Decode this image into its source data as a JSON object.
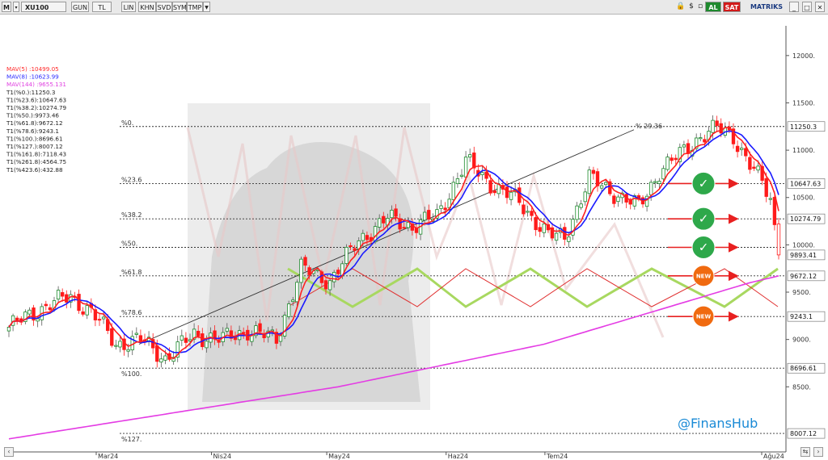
{
  "toolbar": {
    "symbol": "XU100",
    "buttons": [
      "GUN",
      "TL",
      "LIN",
      "KHN",
      "SVD",
      "SYM",
      "TMP"
    ],
    "buy_label": "AL",
    "sell_label": "SAT",
    "brand": "MATRIKS"
  },
  "legend": [
    {
      "text": "MAV(5)   :10499.05",
      "color": "#ff2a2a"
    },
    {
      "text": "MAV(8)   :10623.99",
      "color": "#2a2aff"
    },
    {
      "text": "MAV(144)  :9655.131",
      "color": "#e040e0"
    },
    {
      "text": "T1(%0.):11250.3",
      "color": "#222222"
    },
    {
      "text": "T1(%23.6):10647.63",
      "color": "#222222"
    },
    {
      "text": "T1(%38.2):10274.79",
      "color": "#222222"
    },
    {
      "text": "T1(%50.):9973.46",
      "color": "#222222"
    },
    {
      "text": "T1(%61.8):9672.12",
      "color": "#222222"
    },
    {
      "text": "T1(%78.6):9243.1",
      "color": "#222222"
    },
    {
      "text": "T1(%100.):8696.61",
      "color": "#222222"
    },
    {
      "text": "T1(%127.):8007.12",
      "color": "#222222"
    },
    {
      "text": "T1(%161.8):7118.43",
      "color": "#222222"
    },
    {
      "text": "T1(%261.8):4564.75",
      "color": "#222222"
    },
    {
      "text": "T1(%423.6):432.88",
      "color": "#222222"
    }
  ],
  "colors": {
    "up_candle": "#1a8a2a",
    "down_candle": "#ff1a1a",
    "mav5": "#ff2020",
    "mav8": "#1a1aff",
    "mav144": "#e43ce4",
    "fib_line": "#333333",
    "green_zigzag": "#a8d860",
    "red_zigzag": "#e03030",
    "badge_check": "#2ea84a",
    "badge_new": "#f06a10",
    "arrow": "#e82020",
    "watermark": "#1a8ad6"
  },
  "watermark_text": "@FinansHub",
  "badges": [
    {
      "type": "check",
      "label": "✓"
    },
    {
      "type": "check",
      "label": "✓"
    },
    {
      "type": "check",
      "label": "✓"
    },
    {
      "type": "new",
      "label": "NEW"
    },
    {
      "type": "new",
      "label": "NEW"
    }
  ],
  "chart_data": {
    "type": "candlestick",
    "title": "XU100",
    "ylim": [
      7880,
      12280
    ],
    "y_ticks": [
      8500,
      9000,
      9500,
      10000,
      10500,
      11000,
      11500,
      12000
    ],
    "x_labels": [
      "Mar24",
      "Nis24",
      "May24",
      "Haz24",
      "Tem24",
      "Ağu24"
    ],
    "current_price": 9893.41,
    "trend_line_label": "% 29.36",
    "fib_levels": [
      {
        "label": "%0.",
        "value": 11250.3,
        "price_tag": "11250.3"
      },
      {
        "label": "%23.6",
        "value": 10647.63,
        "price_tag": "10647.63"
      },
      {
        "label": "%38.2",
        "value": 10274.79,
        "price_tag": "10274.79"
      },
      {
        "label": "%50.",
        "value": 9973.46,
        "price_tag": ""
      },
      {
        "label": "%61.8",
        "value": 9672.12,
        "price_tag": "9672.12"
      },
      {
        "label": "%78.6",
        "value": 9243.1,
        "price_tag": "9243.1"
      },
      {
        "label": "%100.",
        "value": 8696.61,
        "price_tag": "8696.61"
      },
      {
        "label": "%127.",
        "value": 8007.12,
        "price_tag": "8007.12"
      }
    ],
    "anchors": [
      {
        "i": 0,
        "c": 9130
      },
      {
        "i": 10,
        "c": 9380
      },
      {
        "i": 15,
        "c": 9450
      },
      {
        "i": 20,
        "c": 9300
      },
      {
        "i": 26,
        "c": 8950
      },
      {
        "i": 32,
        "c": 9000
      },
      {
        "i": 38,
        "c": 8800
      },
      {
        "i": 45,
        "c": 9050
      },
      {
        "i": 52,
        "c": 9000
      },
      {
        "i": 58,
        "c": 9100
      },
      {
        "i": 65,
        "c": 9000
      },
      {
        "i": 71,
        "c": 9750
      },
      {
        "i": 78,
        "c": 9620
      },
      {
        "i": 85,
        "c": 10050
      },
      {
        "i": 92,
        "c": 10280
      },
      {
        "i": 98,
        "c": 10200
      },
      {
        "i": 104,
        "c": 10300
      },
      {
        "i": 111,
        "c": 10880
      },
      {
        "i": 117,
        "c": 10650
      },
      {
        "i": 124,
        "c": 10450
      },
      {
        "i": 131,
        "c": 10100
      },
      {
        "i": 135,
        "c": 10080
      },
      {
        "i": 141,
        "c": 10700
      },
      {
        "i": 147,
        "c": 10550
      },
      {
        "i": 153,
        "c": 10400
      },
      {
        "i": 158,
        "c": 10780
      },
      {
        "i": 163,
        "c": 10950
      },
      {
        "i": 168,
        "c": 11150
      },
      {
        "i": 172,
        "c": 11230
      },
      {
        "i": 176,
        "c": 11150
      },
      {
        "i": 180,
        "c": 10850
      },
      {
        "i": 183,
        "c": 10650
      },
      {
        "i": 185,
        "c": 10480
      },
      {
        "i": 187,
        "c": 9893.41
      }
    ],
    "mav144_points": [
      {
        "i": 0,
        "v": 7950
      },
      {
        "i": 80,
        "v": 8500
      },
      {
        "i": 130,
        "v": 8950
      },
      {
        "i": 180,
        "v": 9600
      },
      {
        "i": 187,
        "v": 9672
      }
    ]
  }
}
